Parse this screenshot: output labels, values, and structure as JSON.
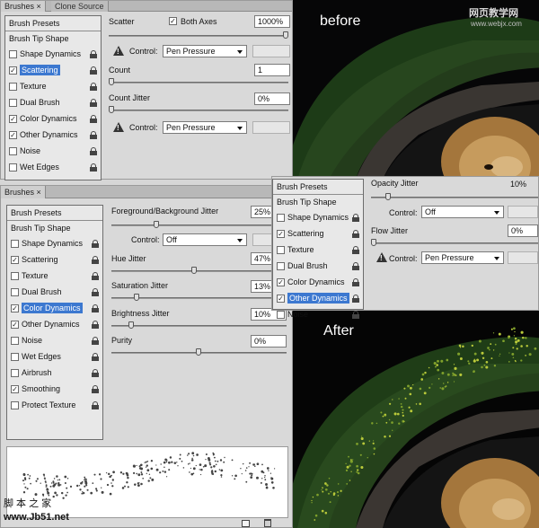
{
  "top_panel": {
    "tabs": [
      "Brushes ×",
      "Clone Source"
    ],
    "presets_label": "Brush Presets",
    "tip_shape_label": "Brush Tip Shape",
    "items": [
      {
        "label": "Shape Dynamics",
        "checked": false,
        "selected": false
      },
      {
        "label": "Scattering",
        "checked": true,
        "selected": true
      },
      {
        "label": "Texture",
        "checked": false,
        "selected": false
      },
      {
        "label": "Dual Brush",
        "checked": false,
        "selected": false
      },
      {
        "label": "Color Dynamics",
        "checked": true,
        "selected": false
      },
      {
        "label": "Other Dynamics",
        "checked": true,
        "selected": false
      },
      {
        "label": "Noise",
        "checked": false,
        "selected": false
      },
      {
        "label": "Wet Edges",
        "checked": false,
        "selected": false
      }
    ],
    "scatter_label": "Scatter",
    "both_axes_label": "Both Axes",
    "both_axes_checked": true,
    "scatter_value": "1000%",
    "control_label": "Control:",
    "control_value": "Pen Pressure",
    "count_label": "Count",
    "count_value": "1",
    "count_jitter_label": "Count Jitter",
    "count_jitter_value": "0%",
    "control2_value": "Pen Pressure"
  },
  "middle_panel": {
    "tabs": [
      "Brushes ×"
    ],
    "presets_label": "Brush Presets",
    "tip_shape_label": "Brush Tip Shape",
    "items": [
      {
        "label": "Shape Dynamics",
        "checked": false,
        "selected": false
      },
      {
        "label": "Scattering",
        "checked": true,
        "selected": false
      },
      {
        "label": "Texture",
        "checked": false,
        "selected": false
      },
      {
        "label": "Dual Brush",
        "checked": false,
        "selected": false
      },
      {
        "label": "Color Dynamics",
        "checked": true,
        "selected": true
      },
      {
        "label": "Other Dynamics",
        "checked": true,
        "selected": false
      },
      {
        "label": "Noise",
        "checked": false,
        "selected": false
      },
      {
        "label": "Wet Edges",
        "checked": false,
        "selected": false
      },
      {
        "label": "Airbrush",
        "checked": false,
        "selected": false
      },
      {
        "label": "Smoothing",
        "checked": true,
        "selected": false
      },
      {
        "label": "Protect Texture",
        "checked": false,
        "selected": false
      }
    ],
    "fg_bg_label": "Foreground/Background Jitter",
    "fg_bg_value": "25%",
    "control_label": "Control:",
    "control_value": "Off",
    "hue_label": "Hue Jitter",
    "hue_value": "47%",
    "sat_label": "Saturation Jitter",
    "sat_value": "13%",
    "bri_label": "Brightness Jitter",
    "bri_value": "10%",
    "purity_label": "Purity",
    "purity_value": "0%"
  },
  "right_panel": {
    "presets_label": "Brush Presets",
    "tip_shape_label": "Brush Tip Shape",
    "items": [
      {
        "label": "Shape Dynamics",
        "checked": false,
        "selected": false
      },
      {
        "label": "Scattering",
        "checked": true,
        "selected": false
      },
      {
        "label": "Texture",
        "checked": false,
        "selected": false
      },
      {
        "label": "Dual Brush",
        "checked": false,
        "selected": false
      },
      {
        "label": "Color Dynamics",
        "checked": true,
        "selected": false
      },
      {
        "label": "Other Dynamics",
        "checked": true,
        "selected": true
      },
      {
        "label": "Noise",
        "checked": false,
        "selected": false
      }
    ],
    "opacity_label": "Opacity Jitter",
    "opacity_value": "10%",
    "control_label": "Control:",
    "control_value": "Off",
    "flow_label": "Flow Jitter",
    "flow_value": "0%",
    "control2_value": "Pen Pressure"
  },
  "photos": {
    "before_label": "before",
    "after_label": "After"
  },
  "watermarks": {
    "top_site": "网页教学网",
    "top_url": "www.webjx.com",
    "bottom_cn": "脚 本 之 家",
    "bottom_url": "www.Jb51.net"
  }
}
